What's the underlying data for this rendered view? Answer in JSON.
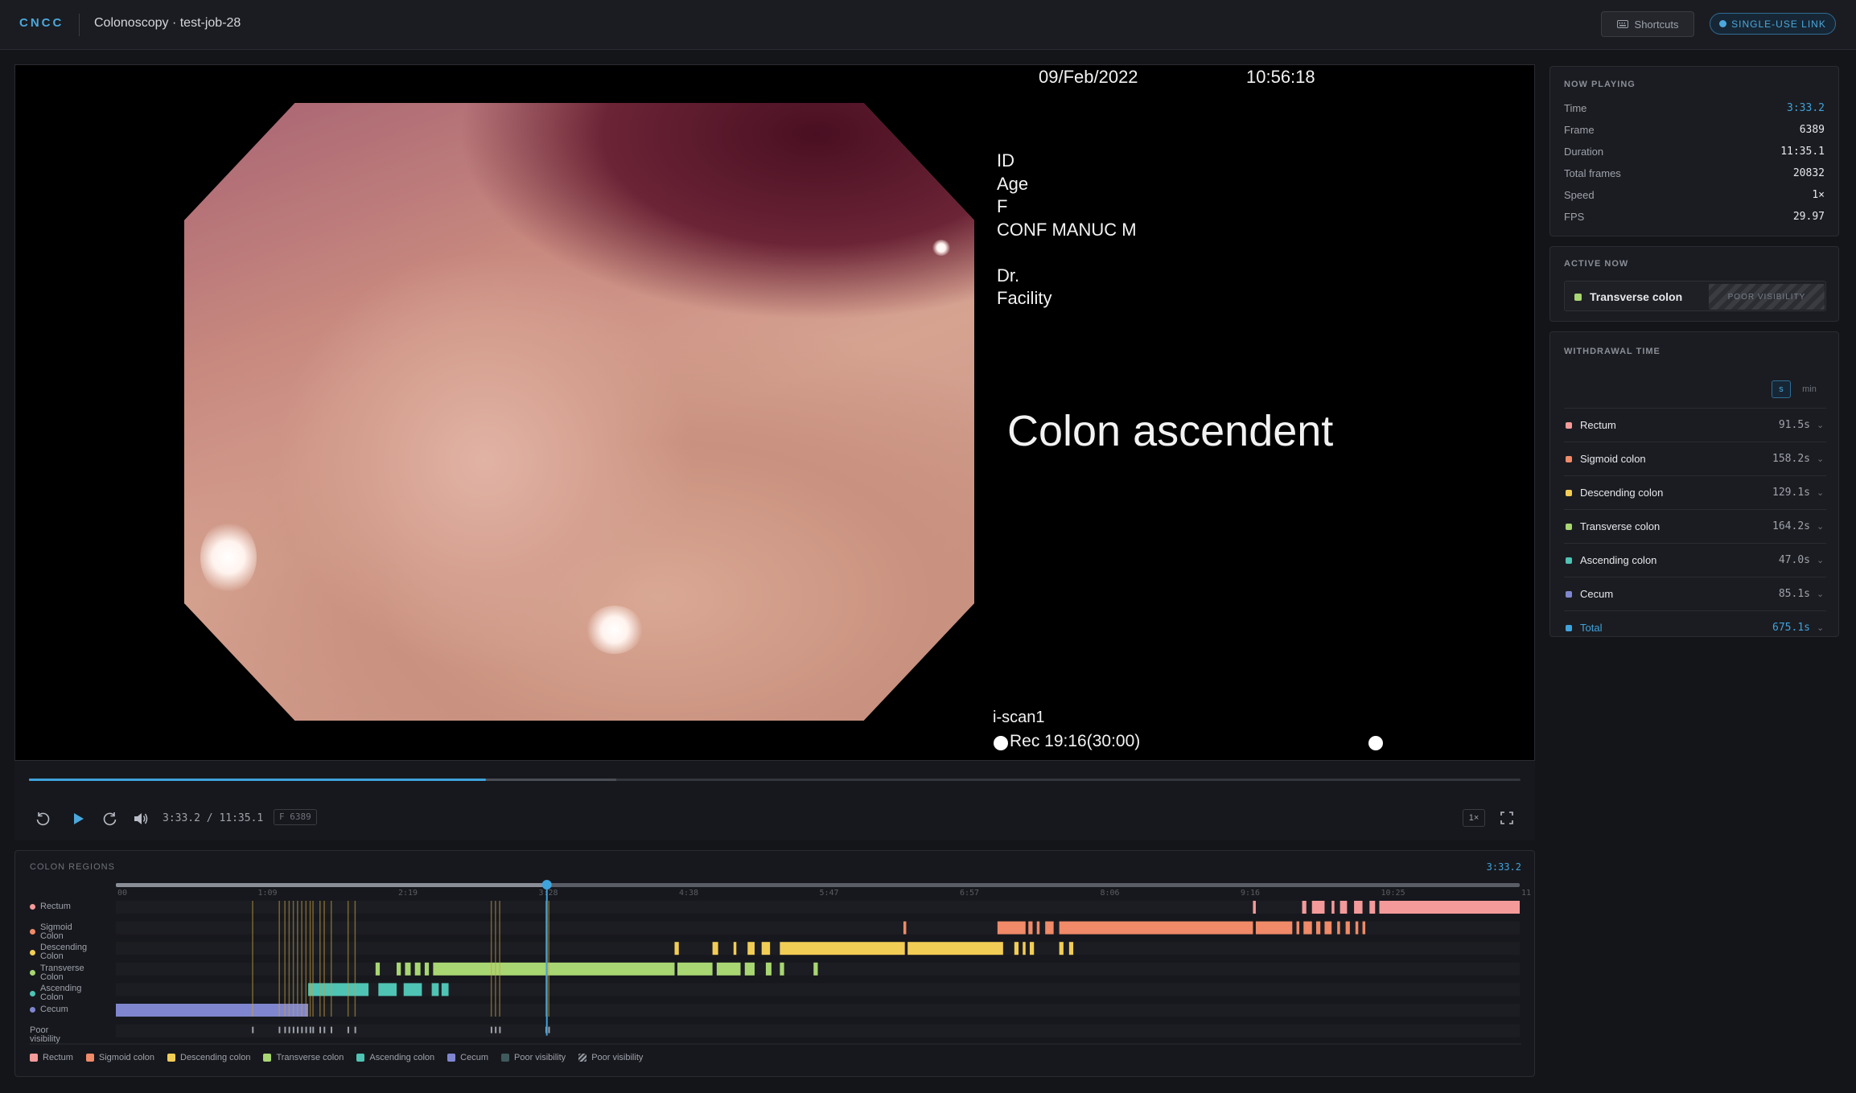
{
  "header": {
    "logo": "CNCC",
    "title": "Colonoscopy · test-job-28",
    "shortcuts_label": "Shortcuts",
    "share_label": "SINGLE-USE LINK"
  },
  "video": {
    "overlay": {
      "date": "09/Feb/2022",
      "clock": "10:56:18",
      "id_label": "ID",
      "age_label": "Age",
      "sex": "F",
      "conf": "CONF MANUC M",
      "doctor_label": "Dr.",
      "facility_label": "Facility",
      "region_caption": "Colon ascendent",
      "mode": "i-scan1",
      "rec": "Rec 19:16(30:00)"
    }
  },
  "player": {
    "time_readout": "3:33.2 / 11:35.1",
    "frame_badge": "F 6389",
    "speed_button": "1×",
    "progress_fraction": 0.307
  },
  "regions_panel": {
    "title": "COLON REGIONS",
    "current_time": "3:33.2",
    "ticks": [
      "00",
      "1:09",
      "2:19",
      "3:28",
      "4:38",
      "5:47",
      "6:57",
      "8:06",
      "9:16",
      "10:25",
      "11"
    ],
    "rows": [
      {
        "label": "Rectum",
        "color": "#f49a9a"
      },
      {
        "label": "Sigmoid Colon",
        "color": "#f08a68"
      },
      {
        "label": "Descending Colon",
        "color": "#f2cd55"
      },
      {
        "label": "Transverse Colon",
        "color": "#a8d672"
      },
      {
        "label": "Ascending Colon",
        "color": "#4fc3b4"
      },
      {
        "label": "Cecum",
        "color": "#7f86cf"
      },
      {
        "label": "Poor visibility",
        "color": "#8a8e97"
      }
    ],
    "legend": [
      {
        "label": "Rectum",
        "color": "#f49a9a"
      },
      {
        "label": "Sigmoid colon",
        "color": "#f08a68"
      },
      {
        "label": "Descending colon",
        "color": "#f2cd55"
      },
      {
        "label": "Transverse colon",
        "color": "#a8d672"
      },
      {
        "label": "Ascending colon",
        "color": "#4fc3b4"
      },
      {
        "label": "Cecum",
        "color": "#7f86cf"
      },
      {
        "label": "Poor visibility",
        "color": "#3e5a5c"
      },
      {
        "label": "Poor visibility",
        "color": "hatched"
      }
    ]
  },
  "now_playing": {
    "title": "NOW PLAYING",
    "rows": [
      {
        "key": "Time",
        "value": "3:33.2",
        "accent": true
      },
      {
        "key": "Frame",
        "value": "6389"
      },
      {
        "key": "Duration",
        "value": "11:35.1"
      },
      {
        "key": "Total frames",
        "value": "20832"
      },
      {
        "key": "Speed",
        "value": "1×"
      },
      {
        "key": "FPS",
        "value": "29.97"
      }
    ]
  },
  "active_now": {
    "title": "ACTIVE NOW",
    "region": "Transverse colon",
    "badge": "POOR VISIBILITY"
  },
  "withdrawal": {
    "title": "WITHDRAWAL TIME",
    "unit_s": "s",
    "unit_min": "min",
    "rows": [
      {
        "label": "Rectum",
        "value": "91.5s",
        "color": "#f49a9a"
      },
      {
        "label": "Sigmoid colon",
        "value": "158.2s",
        "color": "#f08a68"
      },
      {
        "label": "Descending colon",
        "value": "129.1s",
        "color": "#f2cd55"
      },
      {
        "label": "Transverse colon",
        "value": "164.2s",
        "color": "#a8d672"
      },
      {
        "label": "Ascending colon",
        "value": "47.0s",
        "color": "#4fc3b4"
      },
      {
        "label": "Cecum",
        "value": "85.1s",
        "color": "#7f86cf"
      },
      {
        "label": "Total",
        "value": "675.1s",
        "color": "#3fa3dc",
        "accent": true
      }
    ]
  }
}
